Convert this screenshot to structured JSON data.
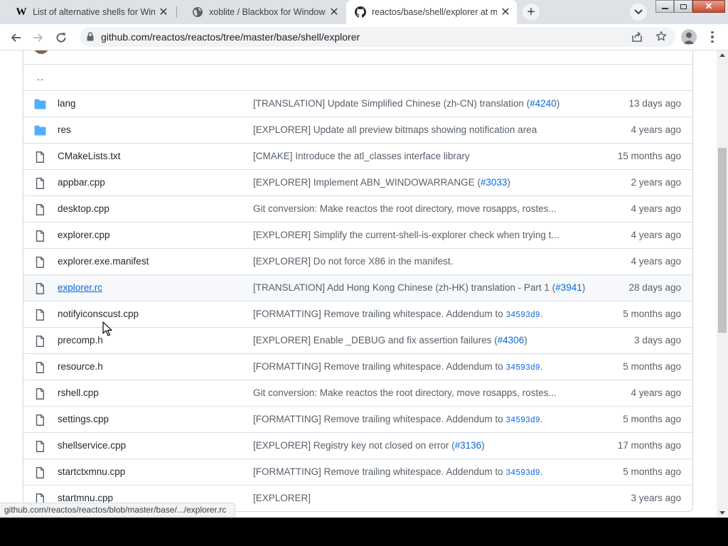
{
  "tabs": [
    {
      "title": "List of alternative shells for Wind",
      "favicon": "wikipedia-icon",
      "active": false
    },
    {
      "title": "xoblite / Blackbox for Windows",
      "favicon": "globe-icon",
      "active": false
    },
    {
      "title": "reactos/base/shell/explorer at m",
      "favicon": "github-icon",
      "active": true
    }
  ],
  "address_bar": {
    "url": "github.com/reactos/reactos/tree/master/base/shell/explorer"
  },
  "parent_dir": "..",
  "files": [
    {
      "type": "folder",
      "name": "lang",
      "message": "[TRANSLATION] Update Simplified Chinese (zh-CN) translation (",
      "pr": "#4240",
      "message_end": ")",
      "sha": "",
      "age": "13 days ago"
    },
    {
      "type": "folder",
      "name": "res",
      "message": "[EXPLORER] Update all preview bitmaps showing notification area",
      "pr": "",
      "message_end": "",
      "sha": "",
      "age": "4 years ago"
    },
    {
      "type": "file",
      "name": "CMakeLists.txt",
      "message": "[CMAKE] Introduce the atl_classes interface library",
      "pr": "",
      "message_end": "",
      "sha": "",
      "age": "15 months ago"
    },
    {
      "type": "file",
      "name": "appbar.cpp",
      "message": "[EXPLORER] Implement ABN_WINDOWARRANGE (",
      "pr": "#3033",
      "message_end": ")",
      "sha": "",
      "age": "2 years ago"
    },
    {
      "type": "file",
      "name": "desktop.cpp",
      "message": "Git conversion: Make reactos the root directory, move rosapps, rostes...",
      "pr": "",
      "message_end": "",
      "sha": "",
      "age": "4 years ago"
    },
    {
      "type": "file",
      "name": "explorer.cpp",
      "message": "[EXPLORER] Simplify the current-shell-is-explorer check when trying t...",
      "pr": "",
      "message_end": "",
      "sha": "",
      "age": "4 years ago"
    },
    {
      "type": "file",
      "name": "explorer.exe.manifest",
      "message": "[EXPLORER] Do not force X86 in the manifest.",
      "pr": "",
      "message_end": "",
      "sha": "",
      "age": "4 years ago"
    },
    {
      "type": "file",
      "name": "explorer.rc",
      "message": "[TRANSLATION] Add Hong Kong Chinese (zh-HK) translation - Part 1 (",
      "pr": "#3941",
      "message_end": ")",
      "sha": "",
      "age": "28 days ago",
      "hover": true
    },
    {
      "type": "file",
      "name": "notifyiconscust.cpp",
      "message": "[FORMATTING] Remove trailing whitespace. Addendum to ",
      "pr": "",
      "message_end": ".",
      "sha": "34593d9",
      "age": "5 months ago"
    },
    {
      "type": "file",
      "name": "precomp.h",
      "message": "[EXPLORER] Enable _DEBUG and fix assertion failures (",
      "pr": "#4306",
      "message_end": ")",
      "sha": "",
      "age": "3 days ago"
    },
    {
      "type": "file",
      "name": "resource.h",
      "message": "[FORMATTING] Remove trailing whitespace. Addendum to ",
      "pr": "",
      "message_end": ".",
      "sha": "34593d9",
      "age": "5 months ago"
    },
    {
      "type": "file",
      "name": "rshell.cpp",
      "message": "Git conversion: Make reactos the root directory, move rosapps, rostes...",
      "pr": "",
      "message_end": "",
      "sha": "",
      "age": "4 years ago"
    },
    {
      "type": "file",
      "name": "settings.cpp",
      "message": "[FORMATTING] Remove trailing whitespace. Addendum to ",
      "pr": "",
      "message_end": ".",
      "sha": "34593d9",
      "age": "5 months ago"
    },
    {
      "type": "file",
      "name": "shellservice.cpp",
      "message": "[EXPLORER] Registry key not closed on error (",
      "pr": "#3136",
      "message_end": ")",
      "sha": "",
      "age": "17 months ago"
    },
    {
      "type": "file",
      "name": "startctxmnu.cpp",
      "message": "[FORMATTING] Remove trailing whitespace. Addendum to ",
      "pr": "",
      "message_end": ".",
      "sha": "34593d9",
      "age": "5 months ago"
    },
    {
      "type": "file",
      "name": "startmnu.cpp",
      "message": "[EXPLORER]",
      "pr": "",
      "message_end": "",
      "sha": "",
      "age": "3 years ago"
    }
  ],
  "status_bar": {
    "text": "github.com/reactos/reactos/blob/master/base/.../explorer.rc"
  },
  "colors": {
    "link": "#0969da",
    "folder": "#54aeff",
    "muted": "#57606a",
    "text": "#24292f"
  }
}
